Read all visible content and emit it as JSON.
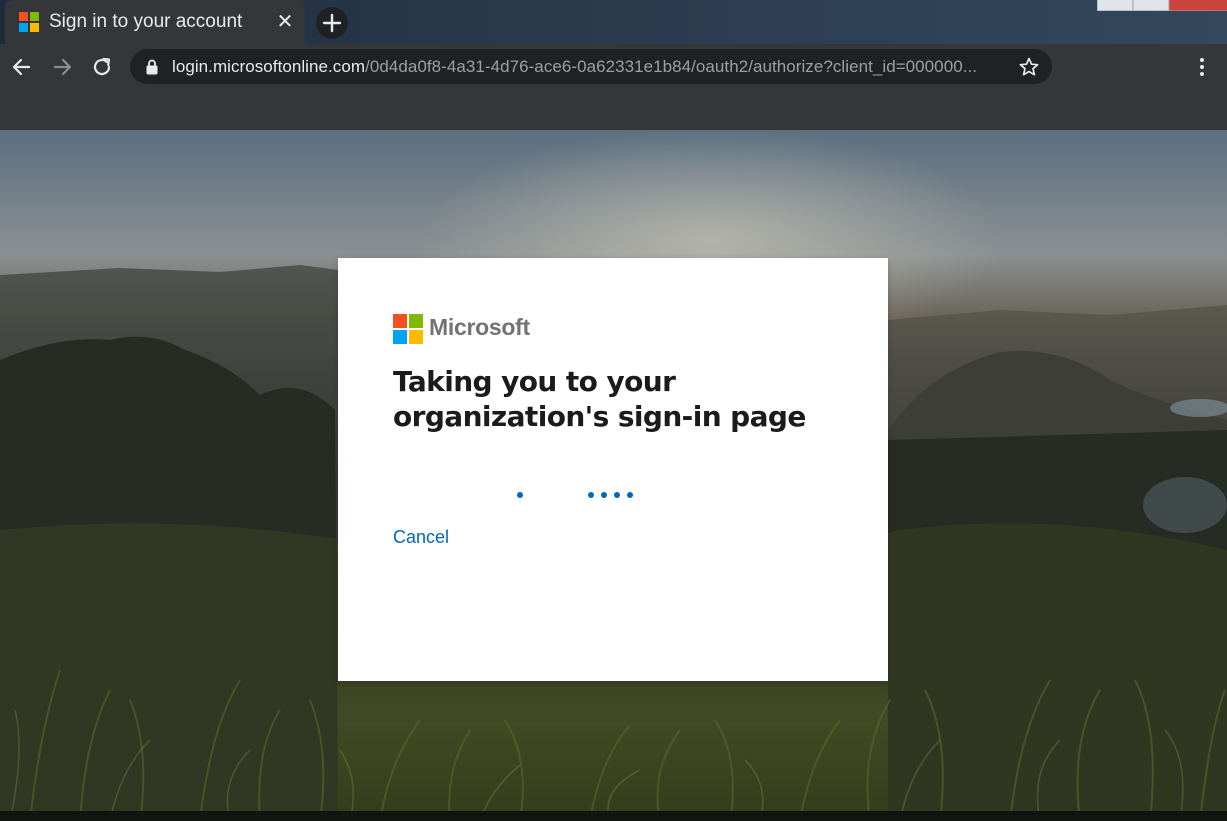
{
  "browser": {
    "tab": {
      "title": "Sign in to your account",
      "close_glyph": "✕",
      "favicon": "microsoft-logo-icon"
    },
    "new_tab_glyph": "+",
    "toolbar": {
      "back_icon": "arrow-left-icon",
      "forward_icon": "arrow-right-icon",
      "reload_icon": "reload-icon",
      "lock_icon": "lock-icon",
      "url_host": "login.microsoftonline.com",
      "url_path": "/0d4da0f8-4a31-4d76-ace6-0a62331e1b84/oauth2/authorize?client_id=000000...",
      "bookmark_icon": "star-icon",
      "menu_icon": "three-dots-vertical-icon"
    }
  },
  "signin": {
    "brand": "Microsoft",
    "title": "Taking you to your organization's sign-in page",
    "cancel_label": "Cancel",
    "accent_color": "#0067b8",
    "logo_colors": {
      "red": "#f25022",
      "green": "#7fba00",
      "blue": "#00a4ef",
      "yellow": "#ffb900"
    }
  }
}
